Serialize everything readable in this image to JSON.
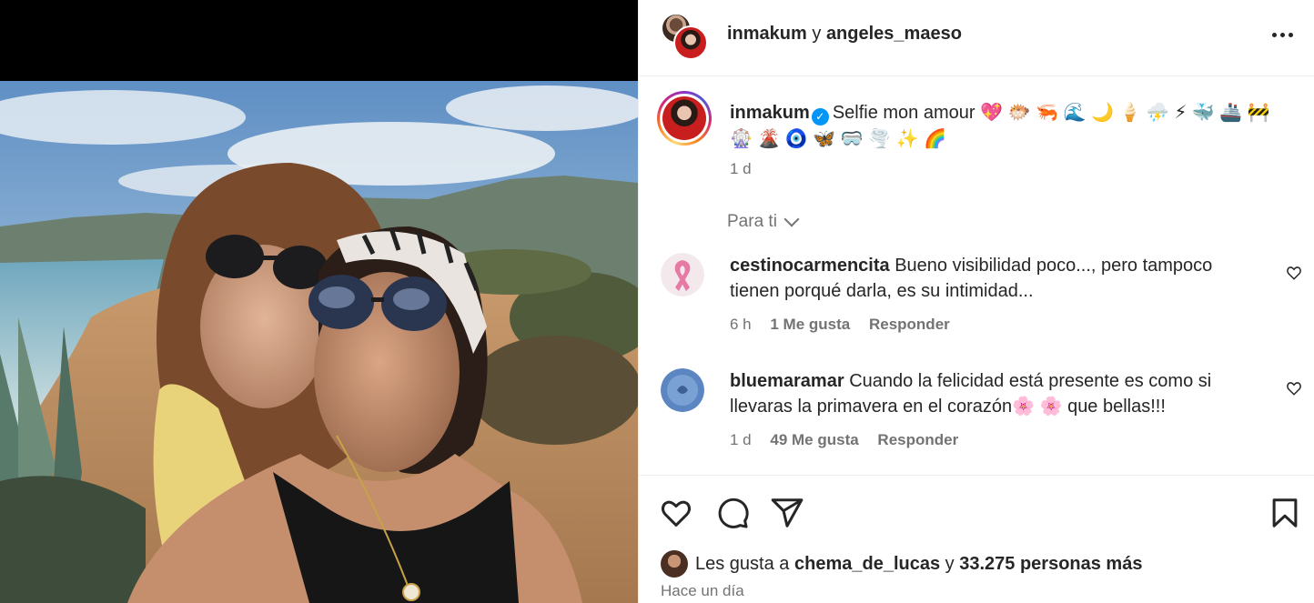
{
  "header": {
    "user1": "inmakum",
    "separator": "y",
    "user2": "angeles_maeso",
    "more_label": "More options"
  },
  "caption": {
    "username": "inmakum",
    "verified_icon": "verified-badge-icon",
    "text": "Selfie mon amour 💖 🐡 🦐 🌊 🌙 🍦 ⛈️ ⚡ 🐳 🚢 🚧 🎡 🌋 🧿 🦋 🥽 🌪️ ✨ 🌈",
    "time": "1 d"
  },
  "section_label": "Para ti",
  "comments": [
    {
      "username": "cestinocarmencita",
      "text": "Bueno visibilidad poco..., pero tampoco tienen porqué darla, es su intimidad...",
      "time": "6 h",
      "likes": "1 Me gusta",
      "reply": "Responder",
      "avatar_icon": "pink-ribbon-icon"
    },
    {
      "username": "bluemaramar",
      "text": "Cuando la felicidad está presente es como si llevaras la primavera en el corazón🌸 🌸  que bellas!!!",
      "time": "1 d",
      "likes": "49 Me gusta",
      "reply": "Responder",
      "avatar_icon": "blue-avatar-icon"
    }
  ],
  "likes": {
    "prefix": "Les gusta a",
    "user": "chema_de_lucas",
    "joiner": "y",
    "others": "33.275 personas más"
  },
  "posted": "Hace un día",
  "colors": {
    "accent": "#0095f6",
    "muted": "#737373",
    "text": "#262626"
  }
}
